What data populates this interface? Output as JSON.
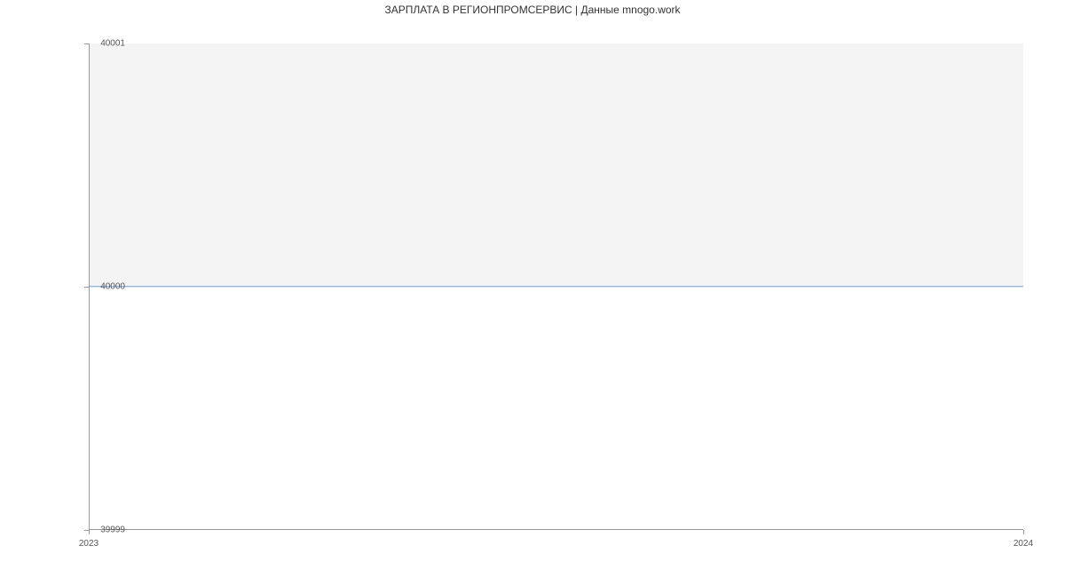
{
  "chart_data": {
    "type": "line",
    "title": "ЗАРПЛАТА В РЕГИОНПРОМСЕРВИС | Данные mnogo.work",
    "xlabel": "",
    "ylabel": "",
    "x": [
      "2023",
      "2024"
    ],
    "values": [
      40000,
      40000
    ],
    "ylim": [
      39999,
      40001
    ],
    "y_ticks": [
      "39999",
      "40000",
      "40001"
    ],
    "x_ticks": [
      "2023",
      "2024"
    ],
    "line_color": "#6a9ee8"
  }
}
